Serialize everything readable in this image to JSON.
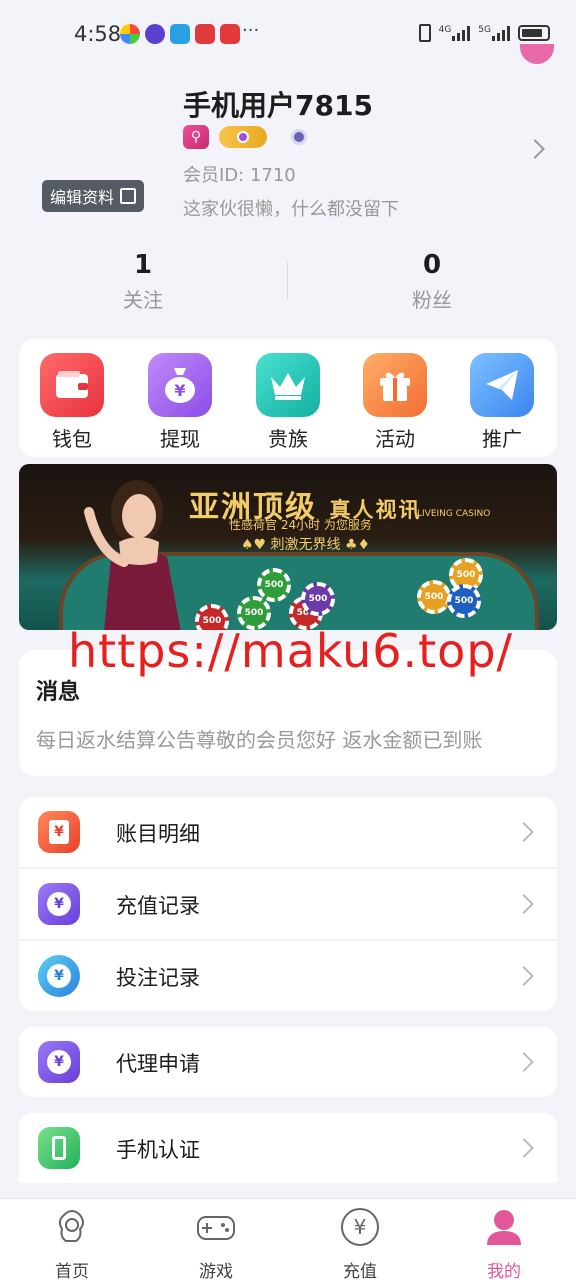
{
  "status_bar": {
    "time": "4:58",
    "more": "···",
    "net1": "4G",
    "net2": "5G"
  },
  "profile": {
    "username": "手机用户7815",
    "member_id": "会员ID: 1710",
    "bio": "这家伙很懒，什么都没留下",
    "edit_label": "编辑资料"
  },
  "stats": [
    {
      "value": "1",
      "label": "关注"
    },
    {
      "value": "0",
      "label": "粉丝"
    }
  ],
  "quick_menu": [
    {
      "label": "钱包",
      "icon": "wallet-icon",
      "color": "#f0454f"
    },
    {
      "label": "提现",
      "icon": "money-bag-icon",
      "color": "#9a5df0",
      "glyph": "¥"
    },
    {
      "label": "贵族",
      "icon": "crown-icon",
      "color": "#1fc8b8"
    },
    {
      "label": "活动",
      "icon": "gift-icon",
      "color": "#f7894a"
    },
    {
      "label": "推广",
      "icon": "paper-plane-icon",
      "color": "#4a9bf4"
    }
  ],
  "banner": {
    "title_main": "亚洲顶级",
    "title_small": "真人视讯",
    "sub": "性感荷官    24小时 为您服务",
    "sub_en": "LIVEING CASINO",
    "line3": "♠♥ 刺激无界线 ♣♦",
    "chip_value": "500"
  },
  "watermark": "https://maku6.top/",
  "message": {
    "title": "消息",
    "text": "每日返水结算公告尊敬的会员您好  返水金额已到账"
  },
  "menu_rows": [
    {
      "label": "账目明细",
      "icon": "ledger-icon",
      "color": "#f0573a",
      "glyph": "¥"
    },
    {
      "label": "充值记录",
      "icon": "money-bag-icon",
      "color": "#7a4ee0",
      "glyph": "¥"
    },
    {
      "label": "投注记录",
      "icon": "coins-icon",
      "color": "#3aa3e8",
      "glyph": "¥"
    },
    {
      "label": "代理申请",
      "icon": "money-bag-icon",
      "color": "#7a4ee0",
      "glyph": "¥"
    },
    {
      "label": "手机认证",
      "icon": "phone-icon",
      "color": "#3cc66a"
    }
  ],
  "tabs": [
    {
      "label": "首页",
      "icon": "home-girl-icon",
      "active": false
    },
    {
      "label": "游戏",
      "icon": "gamepad-icon",
      "active": false
    },
    {
      "label": "充值",
      "icon": "yen-circle-icon",
      "active": false
    },
    {
      "label": "我的",
      "icon": "profile-icon",
      "active": true
    }
  ],
  "colors": {
    "accent": "#e3579a",
    "background": "#f3f4f9"
  }
}
